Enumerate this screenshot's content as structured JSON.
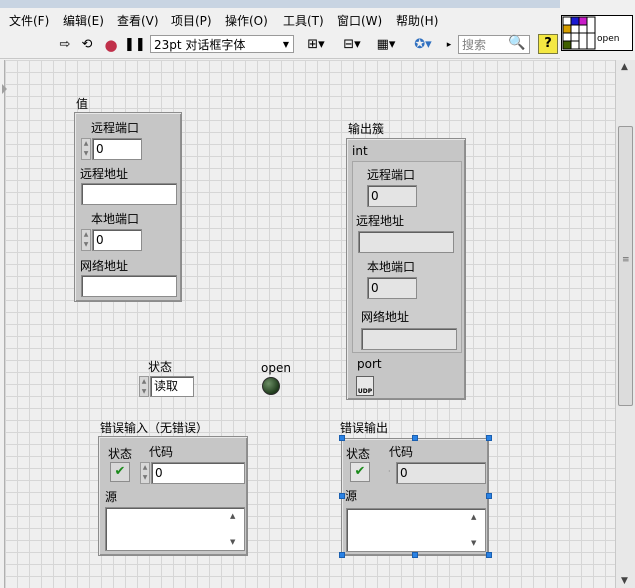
{
  "menu": [
    "文件(F)",
    "编辑(E)",
    "查看(V)",
    "项目(P)",
    "操作(O)",
    "工具(T)",
    "窗口(W)",
    "帮助(H)"
  ],
  "toolbar": {
    "font_name": "23pt 对话框字体",
    "search_placeholder": "搜索",
    "help_label": "?"
  },
  "connector": {
    "label": "open"
  },
  "value_cluster": {
    "title": "值",
    "remote_port_label": "远程端口",
    "remote_port_value": "0",
    "remote_addr_label": "远程地址",
    "remote_addr_value": "",
    "local_port_label": "本地端口",
    "local_port_value": "0",
    "net_addr_label": "网络地址",
    "net_addr_value": ""
  },
  "output_cluster": {
    "title": "输出簇",
    "inner_title": "int",
    "remote_port_label": "远程端口",
    "remote_port_value": "0",
    "remote_addr_label": "远程地址",
    "remote_addr_value": "",
    "local_port_label": "本地端口",
    "local_port_value": "0",
    "net_addr_label": "网络地址",
    "net_addr_value": "",
    "port_label": "port",
    "udp_icon_label": "UDP"
  },
  "state_control": {
    "label": "状态",
    "value": "读取"
  },
  "open_indicator": {
    "label": "open",
    "color": "#2f4f2a"
  },
  "error_in": {
    "title": "错误输入（无错误）",
    "status_label": "状态",
    "code_label": "代码",
    "code_value": "0",
    "source_label": "源",
    "source_value": ""
  },
  "error_out": {
    "title": "错误输出",
    "status_label": "状态",
    "code_label": "代码",
    "code_value": "0",
    "source_label": "源",
    "source_value": ""
  }
}
